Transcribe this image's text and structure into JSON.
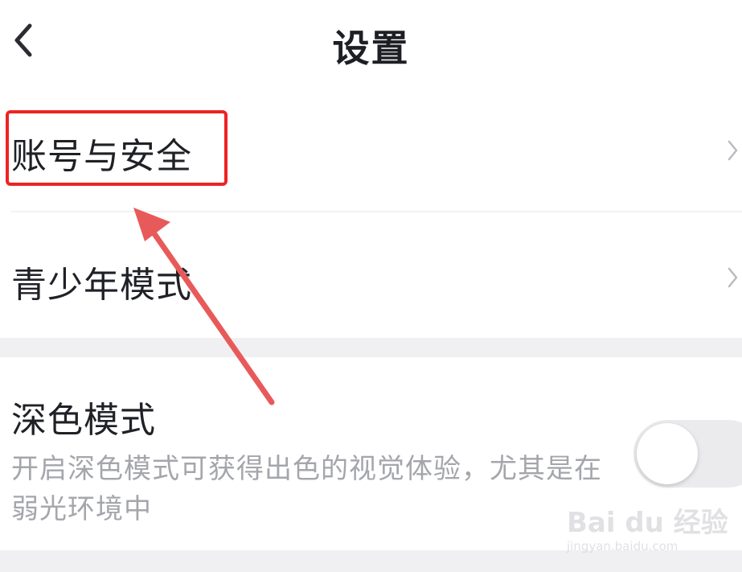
{
  "header": {
    "title": "设置",
    "back_icon": "chevron-left-icon"
  },
  "settings": {
    "account_security": {
      "label": "账号与安全",
      "icon": "chevron-right-icon"
    },
    "teen_mode": {
      "label": "青少年模式",
      "icon": "chevron-right-icon"
    },
    "dark_mode": {
      "label": "深色模式",
      "description": "开启深色模式可获得出色的视觉体验，尤其是在弱光环境中",
      "enabled": false
    }
  },
  "annotation": {
    "highlight_color": "#ee2222",
    "arrow_color": "#e85a5a"
  },
  "watermark": {
    "brand": "Bai du 经验",
    "url": "jingyan.baidu.com"
  }
}
